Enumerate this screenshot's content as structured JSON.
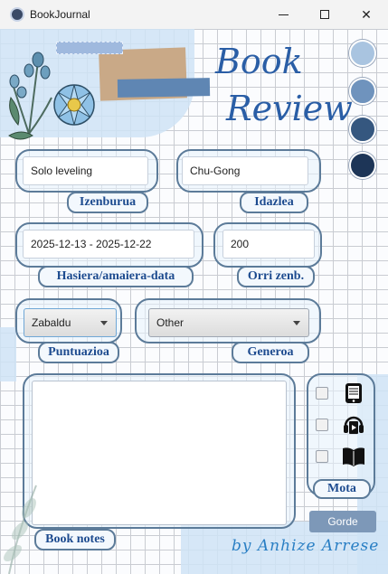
{
  "window": {
    "title": "BookJournal",
    "controls": {
      "minimize": "minimize-icon",
      "maximize": "maximize-icon",
      "close": "close-icon"
    }
  },
  "header": {
    "title_line1": "Book",
    "title_line2": "Review"
  },
  "colors": {
    "accent": "#1d4b8f",
    "frame": "#5c7b99",
    "swatches": [
      "#a9c4e0",
      "#6f93bd",
      "#35577f",
      "#1d3557"
    ]
  },
  "form": {
    "title": {
      "value": "Solo leveling",
      "label": "Izenburua"
    },
    "author": {
      "value": "Chu-Gong",
      "label": "Idazlea"
    },
    "dates": {
      "value": "2025-12-13 - 2025-12-22",
      "label": "Hasiera/amaiera-data"
    },
    "pages": {
      "value": "200",
      "label": "Orri zenb."
    },
    "rating": {
      "selected": "Zabaldu",
      "label": "Puntuazioa"
    },
    "genre": {
      "selected": "Other",
      "label": "Generoa"
    },
    "notes": {
      "value": "",
      "label": "Book notes"
    },
    "type": {
      "label": "Mota",
      "options": [
        {
          "icon": "ebook-reader-icon",
          "checked": false
        },
        {
          "icon": "audiobook-headphones-icon",
          "checked": false
        },
        {
          "icon": "open-book-icon",
          "checked": false
        }
      ]
    },
    "save_label": "Gorde"
  },
  "signature": "by Anhize Arrese"
}
